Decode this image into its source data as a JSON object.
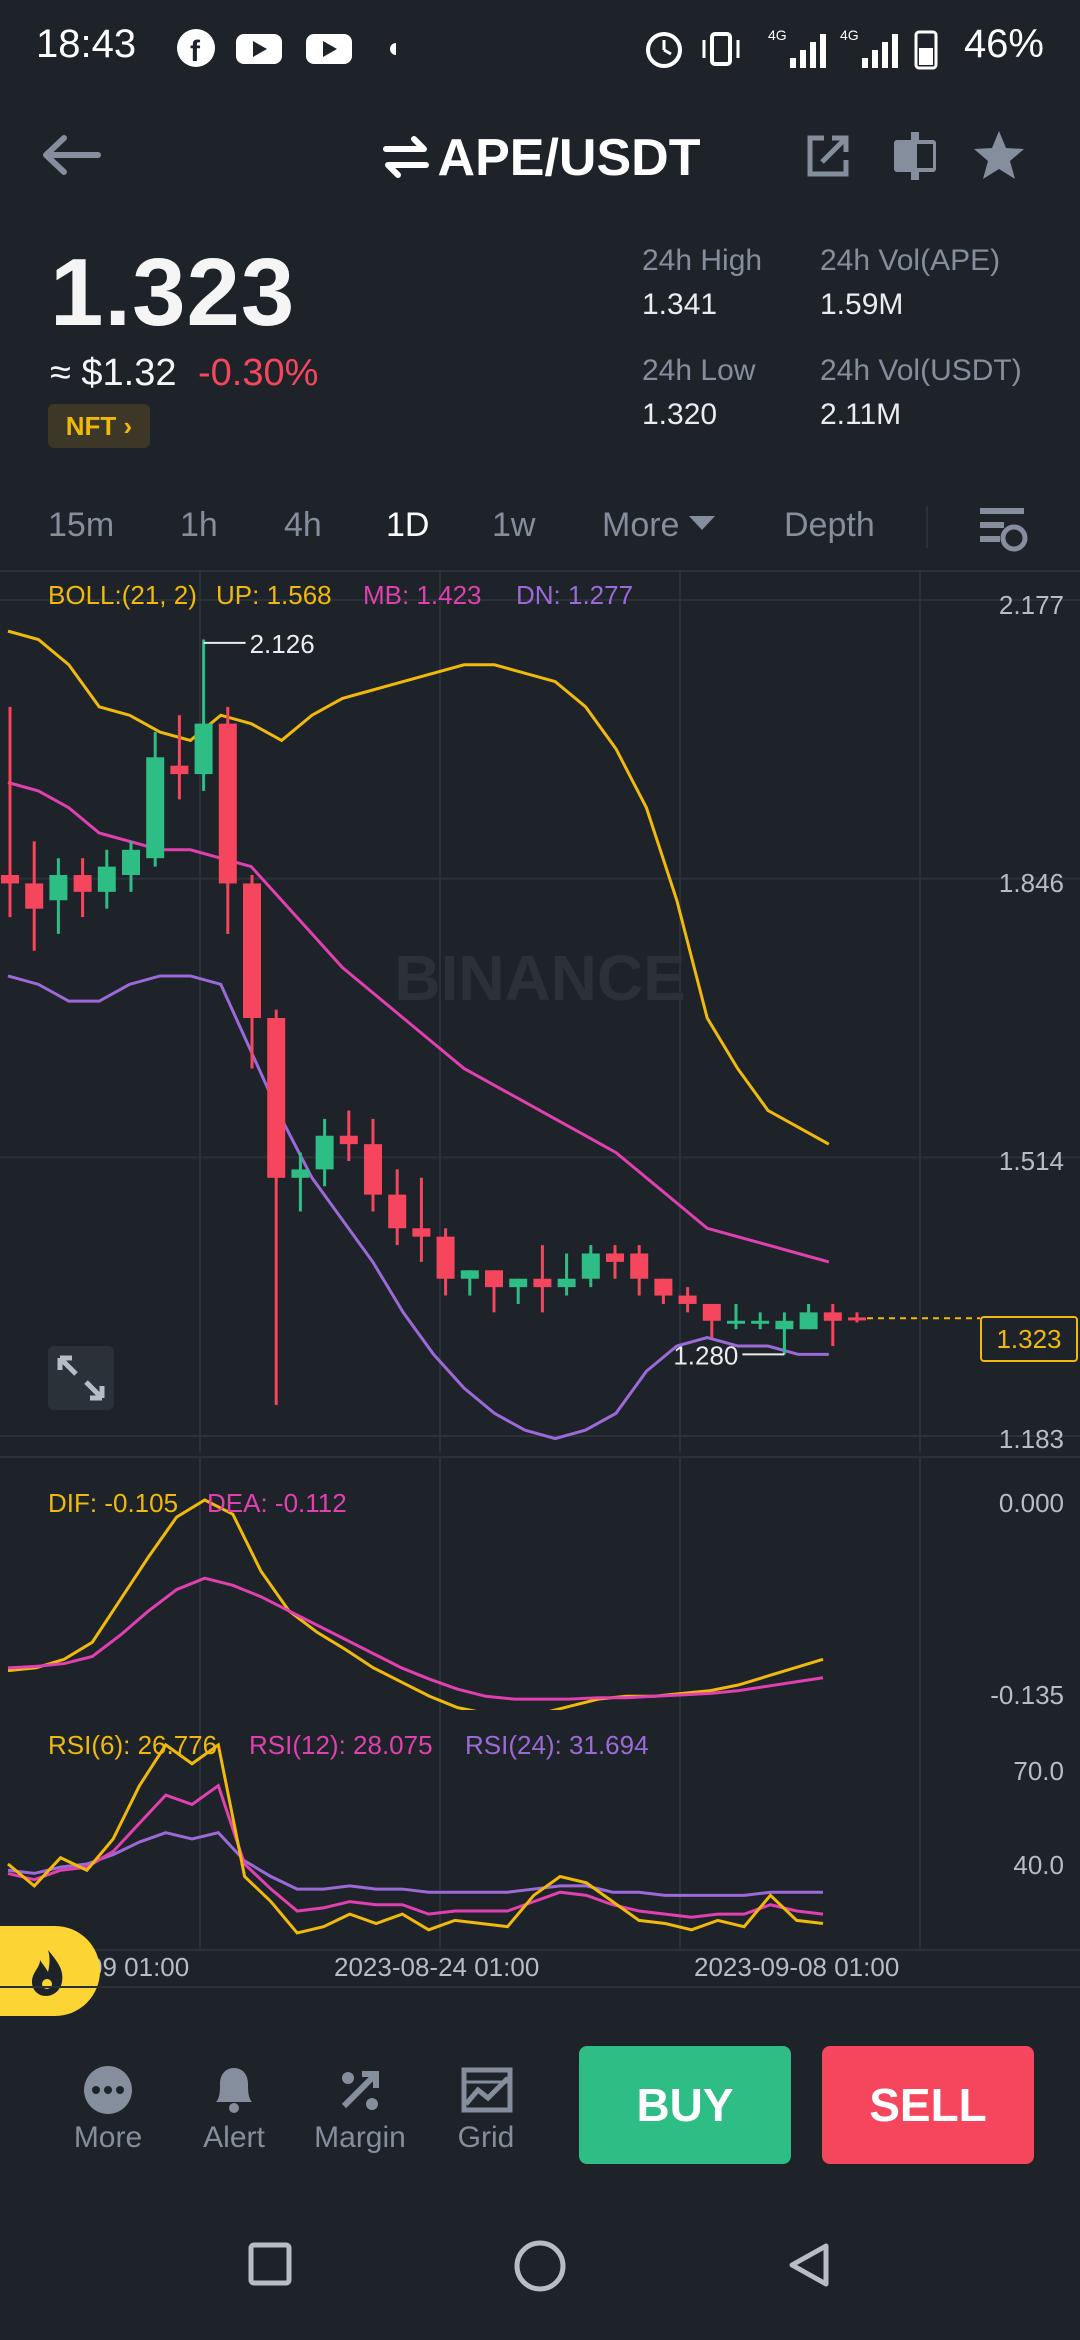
{
  "status_bar": {
    "time": "18:43",
    "battery": "46%",
    "network": "4G"
  },
  "header": {
    "pair": "APE/USDT"
  },
  "ticker": {
    "last_price": "1.323",
    "fiat_price": "≈ $1.32",
    "change": "-0.30%",
    "tag": "NFT",
    "high_label": "24h High",
    "high": "1.341",
    "low_label": "24h Low",
    "low": "1.320",
    "vol_base_label": "24h Vol(APE)",
    "vol_base": "1.59M",
    "vol_quote_label": "24h Vol(USDT)",
    "vol_quote": "2.11M"
  },
  "timeframes": [
    "15m",
    "1h",
    "4h",
    "1D",
    "1w",
    "More",
    "Depth"
  ],
  "active_timeframe": "1D",
  "chart_data": {
    "type": "candlestick",
    "indicators": {
      "boll": {
        "label": "BOLL:(21, 2)",
        "up": "UP: 1.568",
        "mb": "MB: 1.423",
        "dn": "DN: 1.277"
      },
      "macd": {
        "dif": "DIF: -0.105",
        "dea": "DEA: -0.112"
      },
      "rsi": {
        "rsi6": "RSI(6): 26.776",
        "rsi12": "RSI(12): 28.075",
        "rsi24": "RSI(24): 31.694"
      }
    },
    "y_ticks": [
      "2.177",
      "1.846",
      "1.514",
      "1.183"
    ],
    "macd_ticks": [
      "0.000",
      "-0.135"
    ],
    "rsi_ticks": [
      "70.0",
      "40.0"
    ],
    "x_labels": [
      "09 01:00",
      "2023-08-24 01:00",
      "2023-09-08 01:00"
    ],
    "annotations": {
      "high": "2.126",
      "low": "1.280",
      "current": "1.323"
    },
    "watermark": "BINANCE",
    "colors": {
      "up": "#2ebd85",
      "down": "#f6465d",
      "boll_up": "#f0b90b",
      "boll_mb": "#e040b0",
      "boll_dn": "#9c6ad8"
    },
    "candles": [
      {
        "o": 1.85,
        "h": 2.05,
        "c": 1.84,
        "l": 1.8
      },
      {
        "o": 1.84,
        "h": 1.89,
        "c": 1.81,
        "l": 1.76
      },
      {
        "o": 1.82,
        "h": 1.87,
        "c": 1.85,
        "l": 1.78
      },
      {
        "o": 1.85,
        "h": 1.87,
        "c": 1.83,
        "l": 1.8
      },
      {
        "o": 1.83,
        "h": 1.88,
        "c": 1.86,
        "l": 1.81
      },
      {
        "o": 1.85,
        "h": 1.89,
        "c": 1.88,
        "l": 1.83
      },
      {
        "o": 1.87,
        "h": 2.02,
        "c": 1.99,
        "l": 1.86
      },
      {
        "o": 1.98,
        "h": 2.04,
        "c": 1.97,
        "l": 1.94
      },
      {
        "o": 1.97,
        "h": 2.13,
        "c": 2.03,
        "l": 1.95
      },
      {
        "o": 2.03,
        "h": 2.05,
        "c": 1.84,
        "l": 1.78
      },
      {
        "o": 1.84,
        "h": 1.85,
        "c": 1.68,
        "l": 1.62
      },
      {
        "o": 1.68,
        "h": 1.69,
        "c": 1.49,
        "l": 1.22
      },
      {
        "o": 1.49,
        "h": 1.52,
        "c": 1.5,
        "l": 1.45
      },
      {
        "o": 1.5,
        "h": 1.56,
        "c": 1.54,
        "l": 1.48
      },
      {
        "o": 1.54,
        "h": 1.57,
        "c": 1.53,
        "l": 1.51
      },
      {
        "o": 1.53,
        "h": 1.56,
        "c": 1.47,
        "l": 1.45
      },
      {
        "o": 1.47,
        "h": 1.5,
        "c": 1.43,
        "l": 1.41
      },
      {
        "o": 1.43,
        "h": 1.49,
        "c": 1.42,
        "l": 1.39
      },
      {
        "o": 1.42,
        "h": 1.43,
        "c": 1.37,
        "l": 1.35
      },
      {
        "o": 1.37,
        "h": 1.38,
        "c": 1.38,
        "l": 1.35
      },
      {
        "o": 1.38,
        "h": 1.38,
        "c": 1.36,
        "l": 1.33
      },
      {
        "o": 1.36,
        "h": 1.37,
        "c": 1.37,
        "l": 1.34
      },
      {
        "o": 1.37,
        "h": 1.41,
        "c": 1.36,
        "l": 1.33
      },
      {
        "o": 1.36,
        "h": 1.4,
        "c": 1.37,
        "l": 1.35
      },
      {
        "o": 1.37,
        "h": 1.41,
        "c": 1.4,
        "l": 1.36
      },
      {
        "o": 1.4,
        "h": 1.41,
        "c": 1.39,
        "l": 1.37
      },
      {
        "o": 1.4,
        "h": 1.41,
        "c": 1.37,
        "l": 1.35
      },
      {
        "o": 1.37,
        "h": 1.37,
        "c": 1.35,
        "l": 1.34
      },
      {
        "o": 1.35,
        "h": 1.36,
        "c": 1.34,
        "l": 1.33
      },
      {
        "o": 1.34,
        "h": 1.34,
        "c": 1.32,
        "l": 1.3
      },
      {
        "o": 1.32,
        "h": 1.34,
        "c": 1.32,
        "l": 1.31
      },
      {
        "o": 1.32,
        "h": 1.33,
        "c": 1.32,
        "l": 1.31
      },
      {
        "o": 1.31,
        "h": 1.33,
        "c": 1.32,
        "l": 1.28
      },
      {
        "o": 1.31,
        "h": 1.34,
        "c": 1.33,
        "l": 1.31
      },
      {
        "o": 1.33,
        "h": 1.34,
        "c": 1.32,
        "l": 1.29
      },
      {
        "o": 1.324,
        "h": 1.33,
        "c": 1.323,
        "l": 1.318
      }
    ],
    "boll_up": [
      2.14,
      2.13,
      2.1,
      2.05,
      2.04,
      2.02,
      2.01,
      2.04,
      2.03,
      2.01,
      2.04,
      2.06,
      2.07,
      2.08,
      2.09,
      2.1,
      2.1,
      2.09,
      2.08,
      2.05,
      2.0,
      1.93,
      1.82,
      1.68,
      1.62,
      1.57,
      1.55,
      1.53
    ],
    "boll_mb": [
      1.96,
      1.95,
      1.93,
      1.9,
      1.89,
      1.88,
      1.88,
      1.87,
      1.86,
      1.82,
      1.78,
      1.74,
      1.71,
      1.68,
      1.65,
      1.62,
      1.6,
      1.58,
      1.56,
      1.54,
      1.52,
      1.49,
      1.46,
      1.43,
      1.42,
      1.41,
      1.4,
      1.39
    ],
    "boll_dn": [
      1.73,
      1.72,
      1.7,
      1.7,
      1.72,
      1.73,
      1.73,
      1.72,
      1.64,
      1.56,
      1.49,
      1.44,
      1.39,
      1.33,
      1.28,
      1.24,
      1.21,
      1.19,
      1.18,
      1.19,
      1.21,
      1.26,
      1.29,
      1.3,
      1.29,
      1.29,
      1.28,
      1.28
    ],
    "macd_dif": [
      -0.12,
      -0.118,
      -0.112,
      -0.1,
      -0.07,
      -0.04,
      -0.012,
      0.0,
      -0.01,
      -0.05,
      -0.078,
      -0.093,
      -0.105,
      -0.118,
      -0.128,
      -0.138,
      -0.146,
      -0.15,
      -0.152,
      -0.15,
      -0.145,
      -0.14,
      -0.138,
      -0.138,
      -0.136,
      -0.134,
      -0.13,
      -0.124,
      -0.118,
      -0.112
    ],
    "macd_dea": [
      -0.118,
      -0.117,
      -0.115,
      -0.11,
      -0.095,
      -0.078,
      -0.063,
      -0.055,
      -0.06,
      -0.068,
      -0.078,
      -0.088,
      -0.098,
      -0.108,
      -0.118,
      -0.126,
      -0.133,
      -0.138,
      -0.14,
      -0.14,
      -0.14,
      -0.139,
      -0.139,
      -0.138,
      -0.137,
      -0.136,
      -0.134,
      -0.131,
      -0.128,
      -0.125
    ],
    "rsi6": [
      40,
      33,
      42,
      38,
      48,
      65,
      78,
      72,
      78,
      36,
      28,
      18,
      20,
      24,
      21,
      24,
      19,
      22,
      21,
      20,
      30,
      36,
      34,
      28,
      22,
      21,
      19,
      22,
      20,
      30,
      22,
      21
    ],
    "rsi12": [
      37,
      35,
      38,
      39,
      44,
      53,
      62,
      59,
      65,
      40,
      32,
      25,
      26,
      28,
      27,
      27,
      24,
      25,
      25,
      25,
      28,
      31,
      30,
      27,
      25,
      24,
      23,
      24,
      24,
      27,
      25,
      24
    ],
    "rsi24": [
      38,
      37,
      39,
      40,
      43,
      47,
      50,
      48,
      50,
      41,
      36,
      32,
      32,
      33,
      32,
      32,
      31,
      31,
      31,
      31,
      32,
      33,
      33,
      31,
      31,
      30,
      30,
      30,
      30,
      31,
      31,
      31
    ]
  },
  "bottom_nav": [
    {
      "label": "More",
      "icon": "more-icon"
    },
    {
      "label": "Alert",
      "icon": "bell-icon"
    },
    {
      "label": "Margin",
      "icon": "margin-icon"
    },
    {
      "label": "Grid",
      "icon": "grid-icon"
    }
  ],
  "actions": {
    "buy": "BUY",
    "sell": "SELL"
  }
}
